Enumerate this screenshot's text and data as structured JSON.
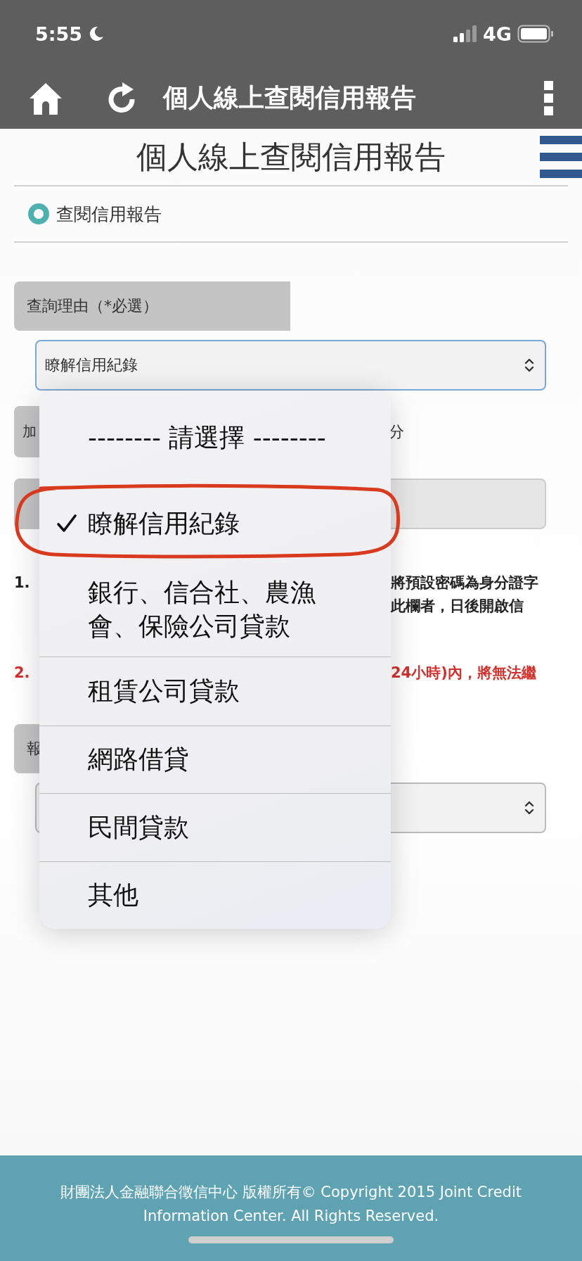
{
  "status_bar": {
    "time": "5:55",
    "network": "4G"
  },
  "toolbar": {
    "title": "個人線上查閱信用報告"
  },
  "page_title": "個人線上查閱信用報告",
  "section": {
    "label": "查閱信用報告",
    "selected": true
  },
  "reason": {
    "label": "查詢理由（*必選）",
    "value": "瞭解信用紀錄"
  },
  "row_2": {
    "label": "加",
    "trailing": "分"
  },
  "notes": [
    {
      "number": "1.",
      "lines": [
        "將預設密碼為身分證字",
        "此欄者，日後開啟信"
      ],
      "warning": false
    },
    {
      "number": "2.",
      "lines": [
        "24小時)內，將無法繼"
      ],
      "warning": true
    }
  ],
  "report_row": {
    "label": "報"
  },
  "dropdown": {
    "options": [
      {
        "label": "-------- 請選擇 --------",
        "selected": false
      },
      {
        "label": "瞭解信用紀錄",
        "selected": true
      },
      {
        "label": "銀行、信合社、農漁會、保險公司貸款",
        "selected": false
      },
      {
        "label": "租賃公司貸款",
        "selected": false
      },
      {
        "label": "網路借貸",
        "selected": false
      },
      {
        "label": "民間貸款",
        "selected": false
      },
      {
        "label": "其他",
        "selected": false
      }
    ]
  },
  "footer": {
    "text": "財團法人金融聯合徵信中心 版權所有© Copyright 2015 Joint Credit Information Center. All Rights Reserved."
  }
}
